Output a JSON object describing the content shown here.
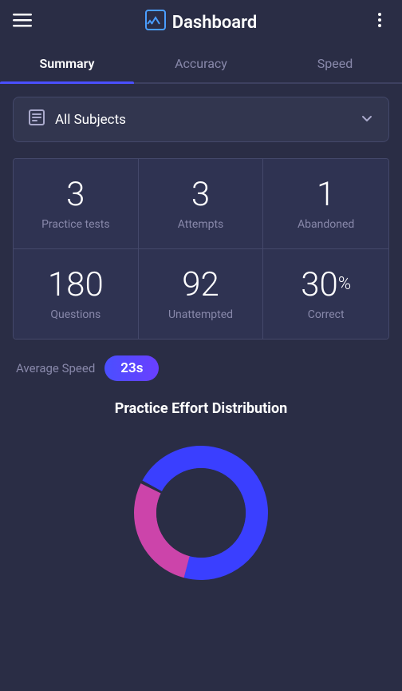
{
  "header": {
    "title": "Dashboard",
    "menu_icon": "≡",
    "more_icon": "⋮",
    "logo_icon": "⧉"
  },
  "tabs": [
    {
      "label": "Summary",
      "active": true
    },
    {
      "label": "Accuracy",
      "active": false
    },
    {
      "label": "Speed",
      "active": false
    }
  ],
  "dropdown": {
    "icon": "📋",
    "label": "All Subjects",
    "chevron": "▾"
  },
  "stats": [
    {
      "number": "3",
      "label": "Practice tests",
      "percent": false
    },
    {
      "number": "3",
      "label": "Attempts",
      "percent": false
    },
    {
      "number": "1",
      "label": "Abandoned",
      "percent": false
    },
    {
      "number": "180",
      "label": "Questions",
      "percent": false
    },
    {
      "number": "92",
      "label": "Unattempted",
      "percent": false
    },
    {
      "number": "30",
      "label": "Correct",
      "percent": true
    }
  ],
  "average_speed": {
    "label": "Average Speed",
    "value": "23s"
  },
  "chart": {
    "title": "Practice Effort Distribution",
    "donut": {
      "segments": [
        {
          "color": "#3a3fff",
          "percent": 72
        },
        {
          "color": "#cc44aa",
          "percent": 28
        }
      ]
    }
  },
  "colors": {
    "bg": "#2a2d45",
    "card": "#2f3352",
    "border": "#44486a",
    "accent_blue": "#4a4fff",
    "accent_pink": "#cc44aa",
    "text_muted": "#8888aa"
  }
}
